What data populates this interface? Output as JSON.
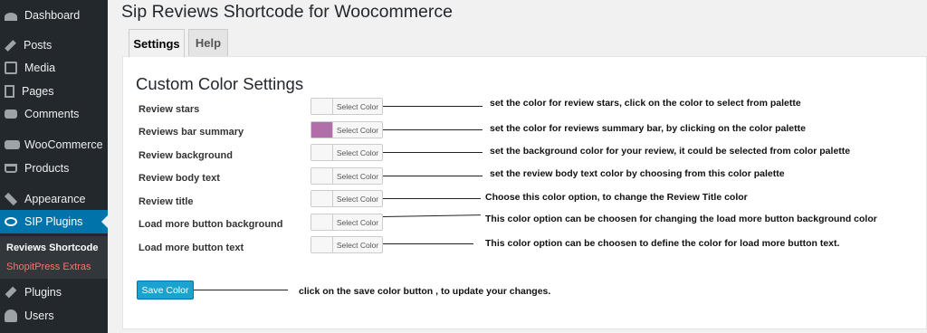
{
  "sidebar": {
    "items": [
      {
        "label": "Dashboard",
        "icon": "dashboard-icon"
      },
      {
        "label": "Posts",
        "icon": "pin-icon"
      },
      {
        "label": "Media",
        "icon": "media-icon"
      },
      {
        "label": "Pages",
        "icon": "pages-icon"
      },
      {
        "label": "Comments",
        "icon": "comments-icon"
      },
      {
        "label": "WooCommerce",
        "icon": "woocommerce-icon"
      },
      {
        "label": "Products",
        "icon": "cart-icon"
      },
      {
        "label": "Appearance",
        "icon": "brush-icon"
      },
      {
        "label": "SIP Plugins",
        "icon": "sip-icon"
      },
      {
        "label": "Plugins",
        "icon": "plug-icon"
      },
      {
        "label": "Users",
        "icon": "user-icon"
      }
    ],
    "submenu": [
      "Reviews Shortcode",
      "ShopitPress Extras"
    ]
  },
  "header": {
    "title": "Sip Reviews Shortcode for Woocommerce"
  },
  "tabs": [
    "Settings",
    "Help"
  ],
  "section": {
    "title": "Custom Color Settings",
    "rows": [
      {
        "label": "Review stars",
        "button": "Select Color",
        "swatch": "#f7f7f7",
        "note": "set the color for review stars, click on the color to select from palette"
      },
      {
        "label": "Reviews bar summary",
        "button": "Select Color",
        "swatch": "#b26ea8",
        "note": "set the color for reviews summary bar, by clicking on the color palette"
      },
      {
        "label": "Review background",
        "button": "Select Color",
        "swatch": "#f7f7f7",
        "note": "set the background color for your review, it could be selected from color palette"
      },
      {
        "label": "Review body text",
        "button": "Select Color",
        "swatch": "#f7f7f7",
        "note": "set the review body text color by choosing from this color palette"
      },
      {
        "label": "Review title",
        "button": "Select Color",
        "swatch": "#f7f7f7",
        "note": "Choose this color option, to change the Review Title color"
      },
      {
        "label": "Load more button background",
        "button": "Select Color",
        "swatch": "#f7f7f7",
        "note": "This color option can be choosen for changing the load more button background color"
      },
      {
        "label": "Load more button text",
        "button": "Select Color",
        "swatch": "#f7f7f7",
        "note": "This color option can be choosen to define the color for load more button text."
      }
    ]
  },
  "save": {
    "label": "Save Color",
    "note": "click on the save color button , to update your changes."
  },
  "colors": {
    "sidebar": "#23282d",
    "active": "#0073aa",
    "button": "#1aa3cf",
    "submenu_accent": "#f4776a"
  }
}
